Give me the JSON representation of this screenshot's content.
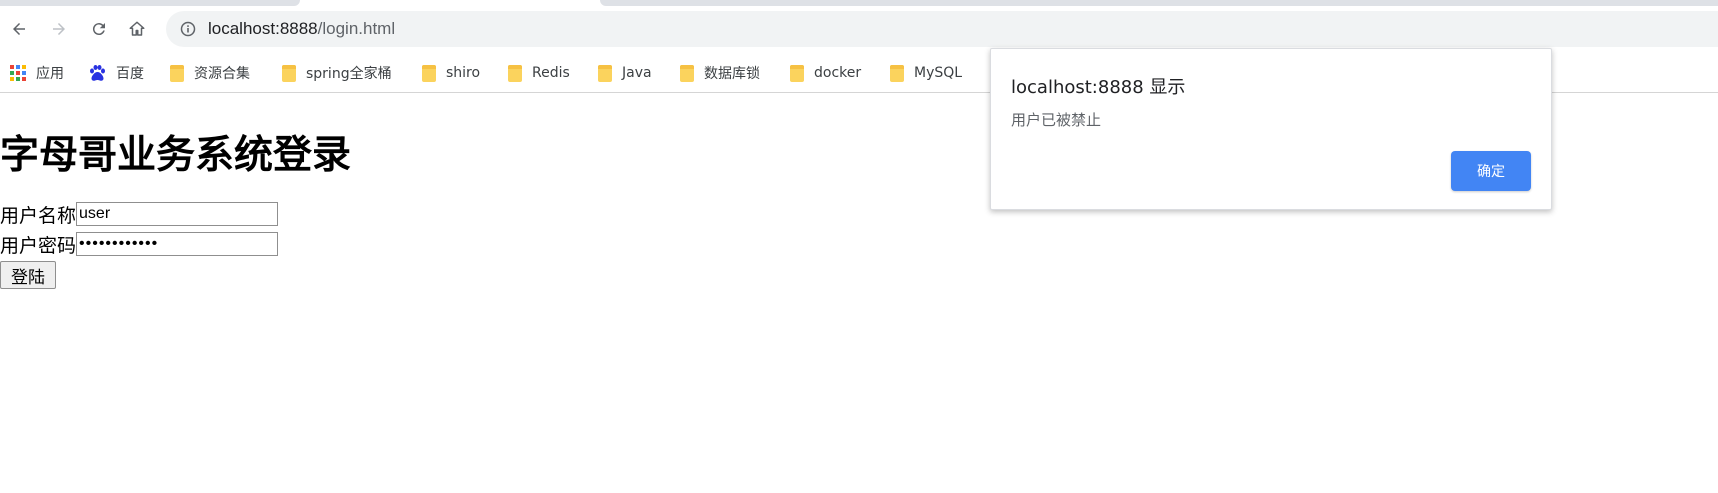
{
  "browser": {
    "url_host": "localhost:8888",
    "url_path": "/login.html",
    "bookmarks": [
      {
        "label": "应用",
        "icon": "apps-grid-icon"
      },
      {
        "label": "百度",
        "icon": "baidu-paw-icon"
      },
      {
        "label": "资源合集",
        "icon": "folder-icon"
      },
      {
        "label": "spring全家桶",
        "icon": "folder-icon"
      },
      {
        "label": "shiro",
        "icon": "folder-icon"
      },
      {
        "label": "Redis",
        "icon": "folder-icon"
      },
      {
        "label": "Java",
        "icon": "folder-icon"
      },
      {
        "label": "数据库锁",
        "icon": "folder-icon"
      },
      {
        "label": "docker",
        "icon": "folder-icon"
      },
      {
        "label": "MySQL",
        "icon": "folder-icon"
      }
    ],
    "colors": {
      "folder": "#fbd35d",
      "omnibox_bg": "#f1f3f4",
      "baidu_blue": "#2932e1"
    }
  },
  "page": {
    "title": "字母哥业务系统登录",
    "username_label": "用户名称",
    "username_value": "user",
    "password_label": "用户密码",
    "password_value": "••••••••••••",
    "login_button": "登陆"
  },
  "alert": {
    "title": "localhost:8888 显示",
    "message": "用户已被禁止",
    "ok_button": "确定",
    "ok_color": "#4285f4"
  }
}
